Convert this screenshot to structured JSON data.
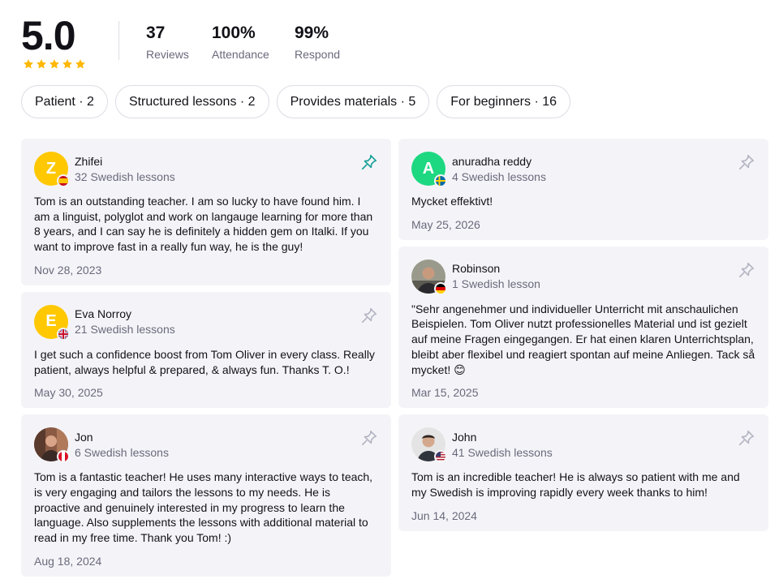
{
  "summary": {
    "rating": "5.0",
    "stars": 5,
    "stats": [
      {
        "value": "37",
        "label": "Reviews"
      },
      {
        "value": "100%",
        "label": "Attendance"
      },
      {
        "value": "99%",
        "label": "Respond"
      }
    ]
  },
  "filters": [
    "Patient · 2",
    "Structured lessons · 2",
    "Provides materials · 5",
    "For beginners · 16"
  ],
  "colors": {
    "star": "#ffb800",
    "pin_active": "#17a097",
    "pin_inactive": "#b5b4c3",
    "card_bg": "#f4f4f8"
  },
  "reviews": [
    {
      "name": "Zhifei",
      "initial": "Z",
      "avatar_color": "#ffc800",
      "flag": "es",
      "lessons": "32 Swedish lessons",
      "pinned": true,
      "text": "Tom is an outstanding teacher. I am so lucky to have found him. I am a linguist, polyglot and work on langauge learning for more than 8 years, and I can say he is definitely a hidden gem on Italki. If you want to improve fast in a really fun way, he is the guy!",
      "date": "Nov 28, 2023"
    },
    {
      "name": "Eva Norroy",
      "initial": "E",
      "avatar_color": "#ffc800",
      "flag": "gb",
      "lessons": "21 Swedish lessons",
      "pinned": false,
      "text": "I get such a confidence boost from Tom Oliver in every class. Really patient, always helpful & prepared, & always fun. Thanks T. O.!",
      "date": "May 30, 2025"
    },
    {
      "name": "Jon",
      "initial": "",
      "avatar_color": "#7a4a3a",
      "flag": "pe",
      "lessons": "6 Swedish lessons",
      "pinned": false,
      "text": "Tom is a fantastic teacher! He uses many interactive ways to teach, is very engaging and tailors the lessons to my needs. He is proactive and genuinely interested in my progress to learn the language. Also supplements the lessons with additional material to read in my free time. Thank you Tom! :)",
      "date": "Aug 18, 2024"
    },
    {
      "name": "anuradha reddy",
      "initial": "A",
      "avatar_color": "#1dd881",
      "flag": "se",
      "lessons": "4 Swedish lessons",
      "pinned": false,
      "text": "Mycket effektivt!",
      "date": "May 25, 2026"
    },
    {
      "name": "Robinson",
      "initial": "",
      "avatar_color": "#8a8a7a",
      "flag": "de",
      "lessons": "1 Swedish lesson",
      "pinned": false,
      "text": "\"Sehr angenehmer und individueller Unterricht mit anschaulichen Beispielen. Tom Oliver nutzt professionelles Material und ist gezielt auf meine Fragen eingegangen. Er hat einen klaren Unterrichtsplan, bleibt aber flexibel und reagiert spontan auf meine Anliegen. Tack så mycket! 😊",
      "date": "Mar 15, 2025"
    },
    {
      "name": "John",
      "initial": "",
      "avatar_color": "#d8d8d8",
      "flag": "us",
      "lessons": "41 Swedish lessons",
      "pinned": false,
      "text": "Tom is an incredible teacher! He is always so patient with me and my Swedish is improving rapidly every week thanks to him!",
      "date": "Jun 14, 2024"
    }
  ]
}
